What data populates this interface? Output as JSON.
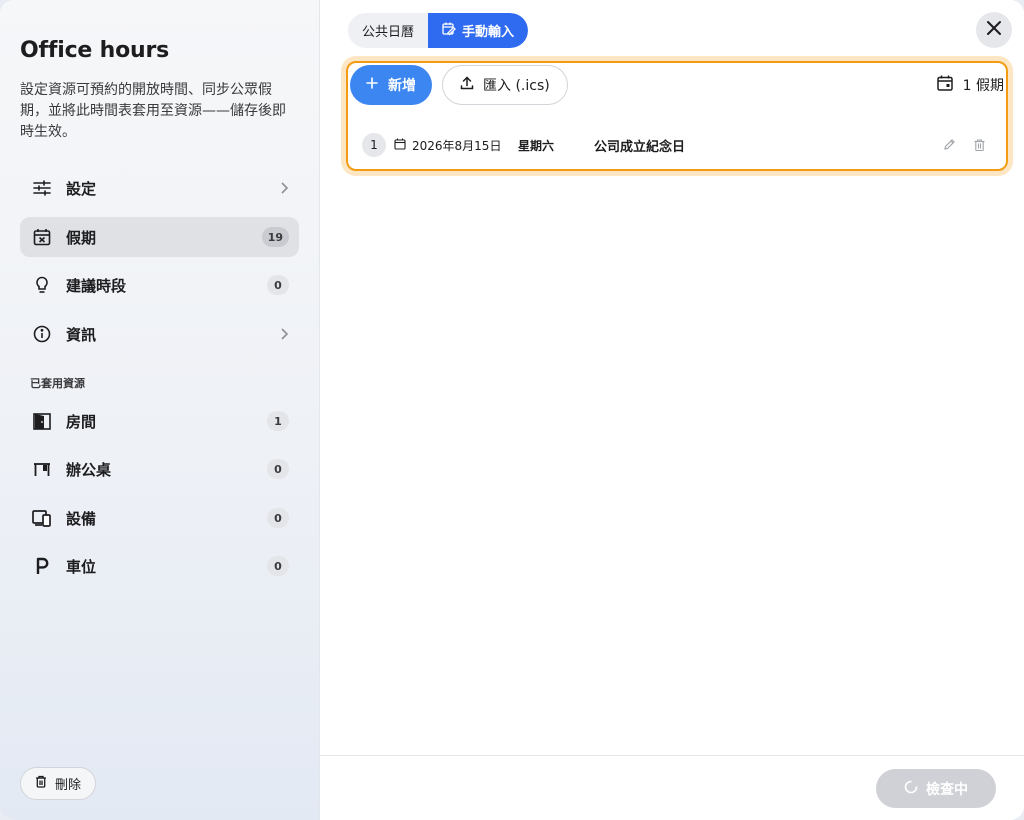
{
  "sidebar": {
    "title": "Office hours",
    "description": "設定資源可預約的開放時間、同步公眾假期，並將此時間表套用至資源——儲存後即時生效。",
    "nav": [
      {
        "label": "設定",
        "icon": "sliders-icon"
      },
      {
        "label": "假期",
        "icon": "calendar-x-icon",
        "badge": "19",
        "active": true
      },
      {
        "label": "建議時段",
        "icon": "lightbulb-icon",
        "badge": "0"
      },
      {
        "label": "資訊",
        "icon": "info-icon"
      }
    ],
    "section_label": "已套用資源",
    "resources": [
      {
        "label": "房間",
        "icon": "door-icon",
        "badge": "1"
      },
      {
        "label": "辦公桌",
        "icon": "desk-icon",
        "badge": "0"
      },
      {
        "label": "設備",
        "icon": "devices-icon",
        "badge": "0"
      },
      {
        "label": "車位",
        "icon": "parking-icon",
        "badge": "0"
      }
    ],
    "delete_label": "刪除"
  },
  "tabs": [
    {
      "label": "公共日曆",
      "selected": false
    },
    {
      "label": "手動輸入",
      "selected": true
    }
  ],
  "toolbar": {
    "add_label": "新增",
    "import_label": "匯入 (.ics)",
    "count_label": "1 假期"
  },
  "holidays": [
    {
      "index": "1",
      "date": "2026年8月15日",
      "weekday": "星期六",
      "name": "公司成立紀念日"
    }
  ],
  "footer": {
    "check_label": "檢查中"
  },
  "colors": {
    "accent": "#2f6bf0",
    "add_button": "#3b86f0",
    "highlight": "#f39b12"
  }
}
